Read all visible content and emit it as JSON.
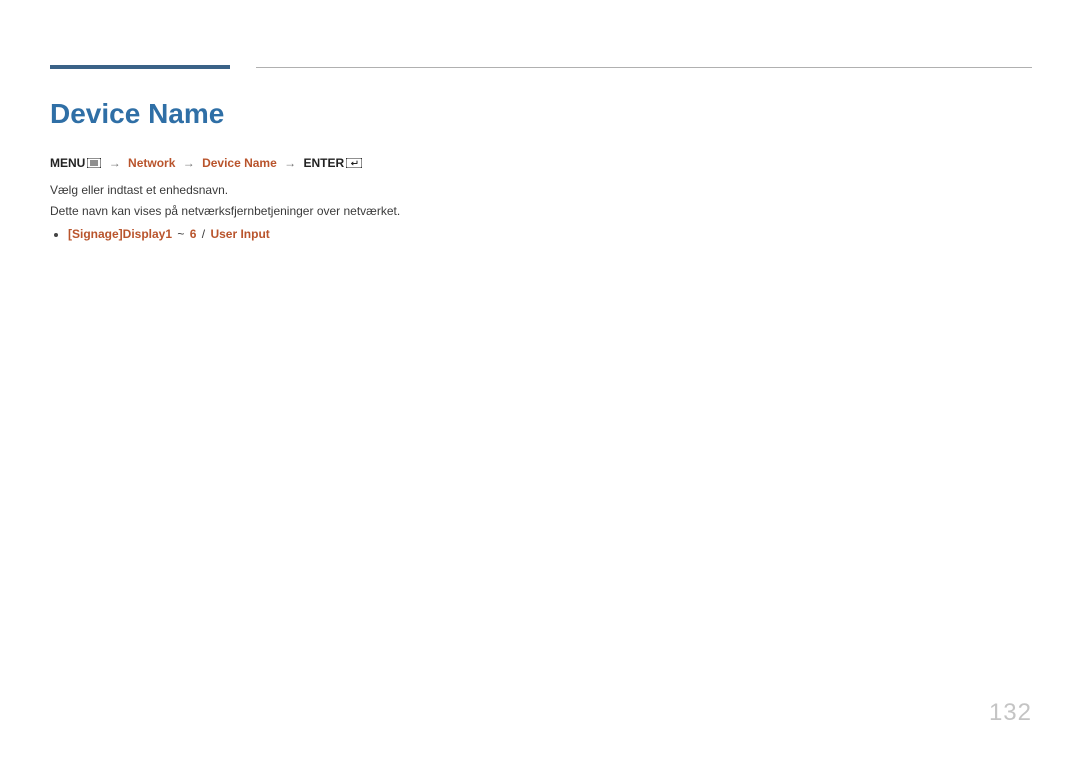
{
  "heading": "Device Name",
  "nav": {
    "menu_label": "MENU",
    "network_label": "Network",
    "device_name_label": "Device Name",
    "enter_label": "ENTER"
  },
  "body": {
    "line1": "Vælg eller indtast et enhedsnavn.",
    "line2": "Dette navn kan vises på netværksfjernbetjeninger over netværket."
  },
  "option": {
    "part1": "[Signage]Display1",
    "tilde": "~",
    "part2": "6",
    "slash": "/",
    "part3": "User Input"
  },
  "page_number": "132"
}
